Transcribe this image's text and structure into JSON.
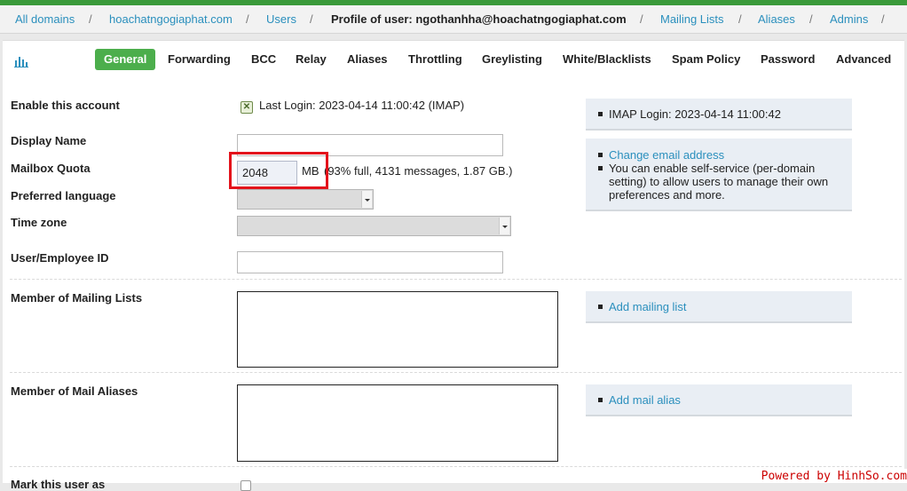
{
  "breadcrumb": {
    "all_domains": "All domains",
    "domain": "hoachatngogiaphat.com",
    "users": "Users",
    "profile_title": "Profile of user: ngothanhha@hoachatngogiaphat.com",
    "mailing_lists": "Mailing Lists",
    "aliases": "Aliases",
    "admins": "Admins",
    "separator": "/"
  },
  "tabs": [
    "General",
    "Forwarding",
    "BCC",
    "Relay",
    "Aliases",
    "Throttling",
    "Greylisting",
    "White/Blacklists",
    "Spam Policy",
    "Password",
    "Advanced"
  ],
  "active_tab": "General",
  "form": {
    "enable_account_label": "Enable this account",
    "last_login": "Last Login: 2023-04-14 11:00:42 (IMAP)",
    "display_name_label": "Display Name",
    "display_name_value": "",
    "mailbox_quota_label": "Mailbox Quota",
    "quota_value": "2048",
    "quota_unit": "MB",
    "quota_usage": "(93% full, 4131 messages, 1.87 GB.)",
    "preferred_language_label": "Preferred language",
    "time_zone_label": "Time zone",
    "employee_id_label": "User/Employee ID",
    "employee_id_value": "",
    "mailing_lists_label": "Member of Mailing Lists",
    "mail_aliases_label": "Member of Mail Aliases",
    "mark_user_label": "Mark this user as"
  },
  "sidebar": {
    "imap_login": "IMAP Login: 2023-04-14 11:00:42",
    "change_email": "Change email address",
    "self_service_note": "You can enable self-service (per-domain setting) to allow users to manage their own preferences and more.",
    "add_mailing_list": "Add mailing list",
    "add_mail_alias": "Add mail alias"
  },
  "footer": {
    "credit": "Powered by HinhSo.com"
  },
  "icons": {
    "chart": "bar-chart-icon",
    "enabled": "enabled-toggle-icon"
  },
  "colors": {
    "accent_green": "#4cae4c",
    "link": "#2a8fbd",
    "highlight": "#e3121b"
  }
}
